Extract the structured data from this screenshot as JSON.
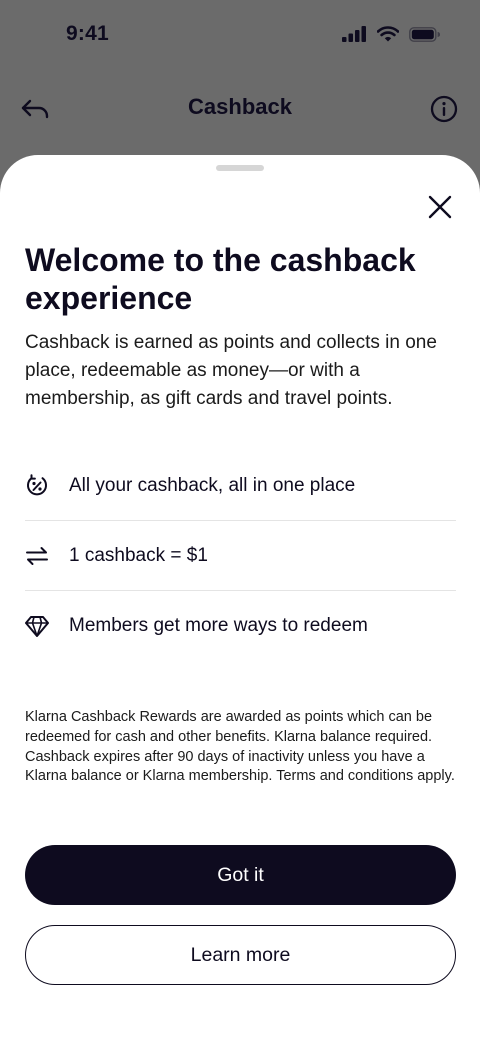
{
  "status_bar": {
    "time": "9:41"
  },
  "nav": {
    "title": "Cashback"
  },
  "sheet": {
    "title": "Welcome to the cashback experience",
    "description": "Cashback is earned as points and collects in one place, redeemable as money—or with a membership, as gift cards and travel points.",
    "features": [
      {
        "icon": "cashback-cycle-icon",
        "label": "All your cashback, all in one place"
      },
      {
        "icon": "exchange-arrows-icon",
        "label": "1 cashback = $1"
      },
      {
        "icon": "diamond-icon",
        "label": "Members get more ways to redeem"
      }
    ],
    "disclaimer": "Klarna Cashback Rewards are awarded as points which can be redeemed for cash and other benefits. Klarna balance required. Cashback expires after 90 days of inactivity unless you have a Klarna balance or Klarna membership. Terms and conditions apply.",
    "primary_button": "Got it",
    "secondary_button": "Learn more"
  },
  "colors": {
    "ink": "#0e0b1f",
    "overlay": "#6b6b6b",
    "sheet": "#ffffff"
  }
}
